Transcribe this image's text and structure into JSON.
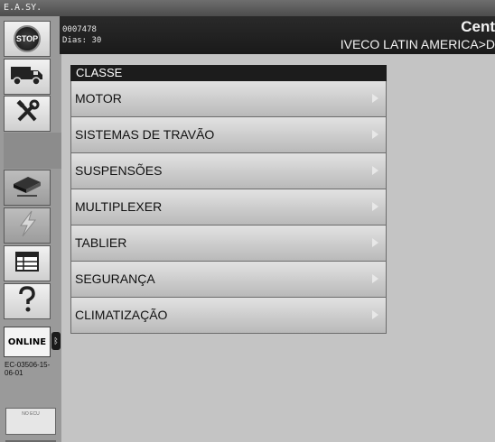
{
  "window": {
    "title": "E.A.SY."
  },
  "header": {
    "code": "0007478",
    "days": "Dias: 30",
    "title": "Cent",
    "path": "IVECO LATIN AMERICA>D"
  },
  "sidebar": {
    "stop_label": "STOP",
    "items": [
      {
        "name": "truck-icon"
      },
      {
        "name": "tools-icon"
      },
      {
        "name": "ecu-device-icon"
      },
      {
        "name": "lightning-icon"
      },
      {
        "name": "table-icon"
      },
      {
        "name": "help-icon"
      }
    ],
    "status_label": "ONLINE",
    "device_id": "EC-03506-15-06-01",
    "no_ecu_label": "NO ECU"
  },
  "menu": {
    "header": "CLASSE",
    "items": [
      {
        "label": "MOTOR"
      },
      {
        "label": "SISTEMAS DE TRAVÃO"
      },
      {
        "label": "SUSPENSÕES"
      },
      {
        "label": "MULTIPLEXER"
      },
      {
        "label": "TABLIER"
      },
      {
        "label": "SEGURANÇA"
      },
      {
        "label": "CLIMATIZAÇÃO"
      }
    ]
  }
}
